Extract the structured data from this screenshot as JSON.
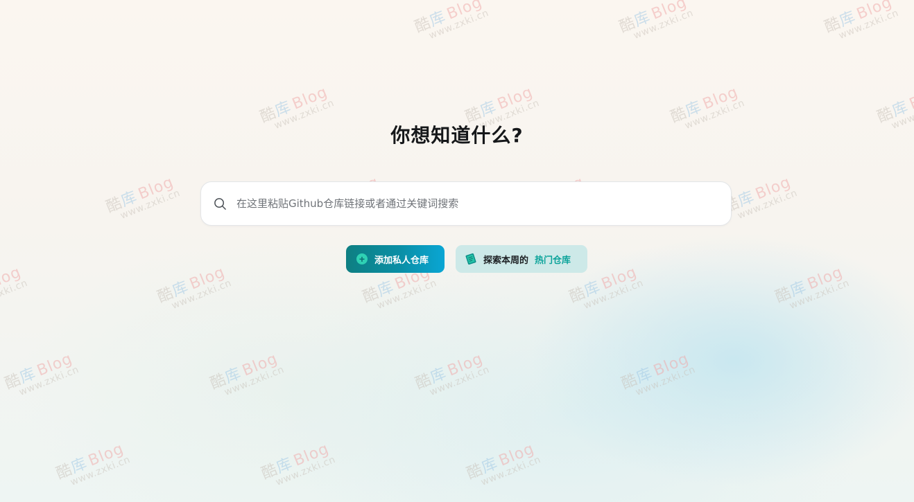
{
  "hero": {
    "title": "你想知道什么?"
  },
  "search": {
    "placeholder": "在这里粘贴Github仓库链接或者通过关键词搜索",
    "value": "",
    "icon": "search-icon"
  },
  "actions": {
    "add_private_repo": {
      "label": "添加私人仓库",
      "icon": "plus-circle-icon"
    },
    "explore_weekly": {
      "label_prefix": "探索本周的",
      "label_highlight": "热门仓库",
      "icon": "book-icon"
    }
  },
  "watermark": {
    "line1_part1": "酷",
    "line1_part2": "库",
    "line1_part3": "Blog",
    "line2": "www.zxki.cn"
  },
  "colors": {
    "accent": "#0a8fa6",
    "accent_gradient_start": "#0e7f82",
    "accent_gradient_end": "#0aa6d4",
    "highlight_text": "#0ba39a",
    "explore_bg": "#cde9e8",
    "title": "#16181a"
  }
}
